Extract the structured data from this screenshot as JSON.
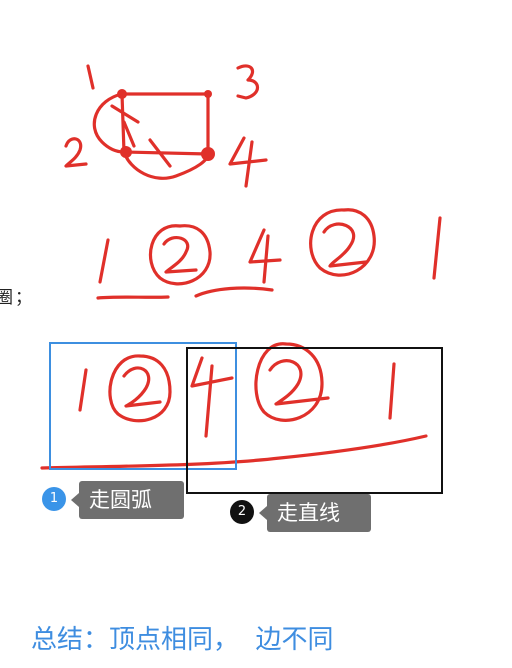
{
  "side_text": "圈；",
  "annotations": [
    {
      "number": "1",
      "label": "走圆弧",
      "marker_color": "#3a94e8",
      "box_color": "#3d8fe0"
    },
    {
      "number": "2",
      "label": "走直线",
      "marker_color": "#111111",
      "box_color": "#111111"
    }
  ],
  "summary": "总结：顶点相同，  边不同",
  "colors": {
    "ink": "#e0302a",
    "summary": "#3e8de0",
    "tag": "#6f6f6f"
  }
}
